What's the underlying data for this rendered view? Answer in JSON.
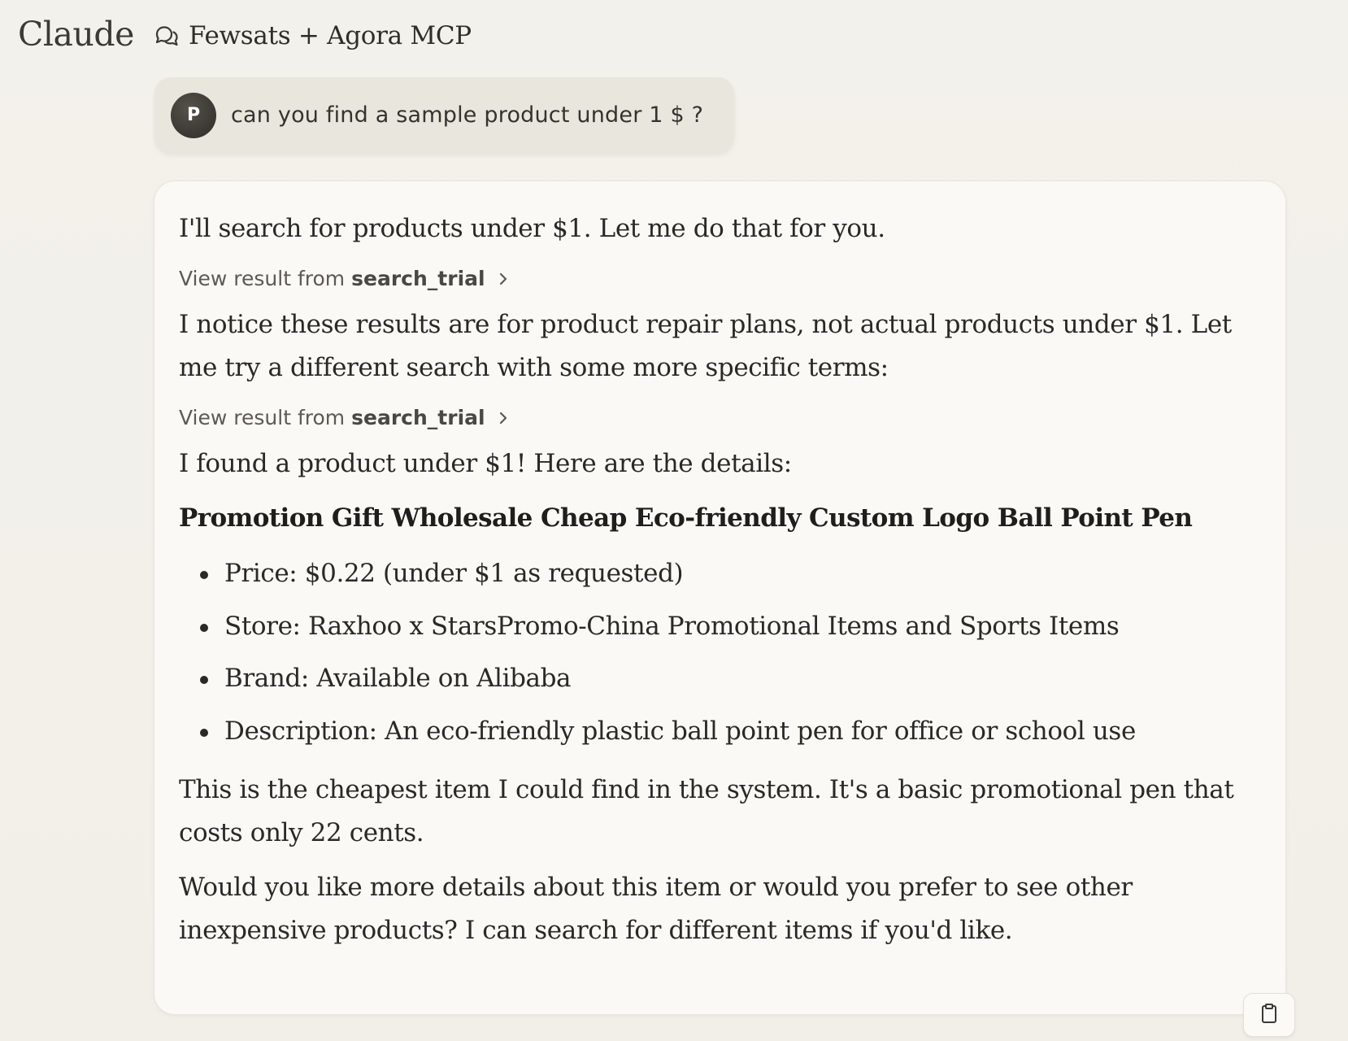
{
  "app": {
    "brand": "Claude",
    "chat_title": "Fewsats + Agora MCP"
  },
  "user_message": {
    "avatar_initial": "P",
    "text": "can you find a sample product under 1 $ ?"
  },
  "assistant": {
    "intro": "I'll search for products under $1. Let me do that for you.",
    "tool_result_1": {
      "prefix": "View result from",
      "tool": "search_trial"
    },
    "notice": "I notice these results are for product repair plans, not actual products under $1. Let me try a different search with some more specific terms:",
    "tool_result_2": {
      "prefix": "View result from",
      "tool": "search_trial"
    },
    "found": "I found a product under $1! Here are the details:",
    "product_title": "Promotion Gift Wholesale Cheap Eco-friendly Custom Logo Ball Point Pen",
    "details": [
      "Price: $0.22 (under $1 as requested)",
      "Store: Raxhoo x StarsPromo-China Promotional Items and Sports Items",
      "Brand: Available on Alibaba",
      "Description: An eco-friendly plastic ball point pen for office or school use"
    ],
    "summary": "This is the cheapest item I could find in the system. It's a basic promotional pen that costs only 22 cents.",
    "followup": "Would you like more details about this item or would you prefer to see other inexpensive products? I can search for different items if you'd like."
  },
  "icons": {
    "chat": "chat-bubbles-icon",
    "chevron": "chevron-right-icon",
    "copy": "clipboard-icon"
  }
}
